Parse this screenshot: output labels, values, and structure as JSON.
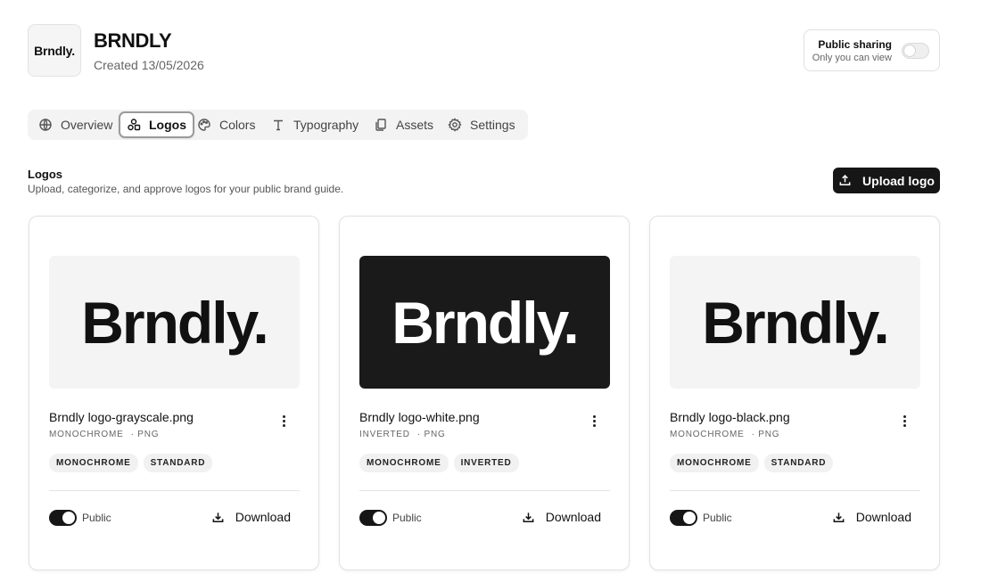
{
  "brand": {
    "thumb_text": "Brndly.",
    "name": "BRNDLY",
    "created": "Created 13/05/2026"
  },
  "sharing": {
    "title": "Public sharing",
    "subtitle": "Only you can view",
    "enabled": false
  },
  "tabs": [
    {
      "label": "Overview",
      "icon": "globe-icon",
      "active": false
    },
    {
      "label": "Logos",
      "icon": "shapes-icon",
      "active": true
    },
    {
      "label": "Colors",
      "icon": "palette-icon",
      "active": false
    },
    {
      "label": "Typography",
      "icon": "type-icon",
      "active": false
    },
    {
      "label": "Assets",
      "icon": "files-icon",
      "active": false
    },
    {
      "label": "Settings",
      "icon": "gear-icon",
      "active": false
    }
  ],
  "section": {
    "title": "Logos",
    "subtitle": "Upload, categorize, and approve logos for your public brand guide.",
    "upload_label": "Upload logo"
  },
  "logos": [
    {
      "preview_text": "Brndly.",
      "preview_style": "light",
      "file_name": "Brndly logo-grayscale.png",
      "category": "MONOCHROME",
      "format": "· PNG",
      "tags": [
        "MONOCHROME",
        "STANDARD"
      ],
      "public_label": "Public",
      "is_public": true,
      "download_label": "Download"
    },
    {
      "preview_text": "Brndly.",
      "preview_style": "dark",
      "file_name": "Brndly logo-white.png",
      "category": "INVERTED",
      "format": "· PNG",
      "tags": [
        "MONOCHROME",
        "INVERTED"
      ],
      "public_label": "Public",
      "is_public": true,
      "download_label": "Download"
    },
    {
      "preview_text": "Brndly.",
      "preview_style": "light",
      "file_name": "Brndly logo-black.png",
      "category": "MONOCHROME",
      "format": "· PNG",
      "tags": [
        "MONOCHROME",
        "STANDARD"
      ],
      "public_label": "Public",
      "is_public": true,
      "download_label": "Download"
    }
  ],
  "colors": {
    "accent": "#161616",
    "tab_bar": "#f3f3f3",
    "preview_light": "#f4f4f4",
    "preview_dark": "#1a1a1a"
  }
}
